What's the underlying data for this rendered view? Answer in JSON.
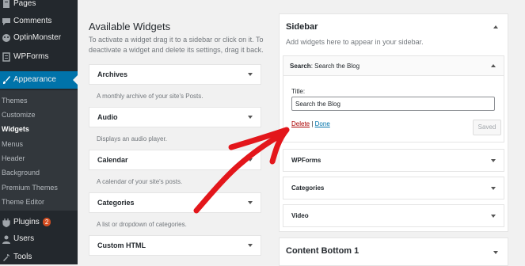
{
  "admin_menu": {
    "pages": "Pages",
    "comments": "Comments",
    "optinmonster": "OptinMonster",
    "wpforms": "WPForms",
    "appearance": "Appearance",
    "plugins": "Plugins",
    "plugins_badge": "2",
    "users": "Users",
    "tools": "Tools",
    "submenu": [
      "Themes",
      "Customize",
      "Widgets",
      "Menus",
      "Header",
      "Background",
      "Premium Themes",
      "Theme Editor"
    ]
  },
  "available": {
    "title": "Available Widgets",
    "description": "To activate a widget drag it to a sidebar or click on it. To deactivate a widget and delete its settings, drag it back.",
    "widgets": [
      {
        "name": "Archives",
        "desc": "A monthly archive of your site's Posts."
      },
      {
        "name": "Audio",
        "desc": "Displays an audio player."
      },
      {
        "name": "Calendar",
        "desc": "A calendar of your site's posts."
      },
      {
        "name": "Categories",
        "desc": "A list or dropdown of categories."
      },
      {
        "name": "Custom HTML",
        "desc": ""
      }
    ]
  },
  "sidebar": {
    "title": "Sidebar",
    "description": "Add widgets here to appear in your sidebar.",
    "search_widget": {
      "name": "Search",
      "subtitle": ": Search the Blog",
      "field_label": "Title:",
      "field_value": "Search the Blog",
      "delete": "Delete",
      "separator": " | ",
      "done": "Done",
      "saved": "Saved"
    },
    "widgets": [
      "WPForms",
      "Categories",
      "Video"
    ]
  },
  "content_bottom": {
    "title": "Content Bottom 1"
  },
  "colors": {
    "admin_bg": "#23282d",
    "active": "#0073aa",
    "arrow": "#e3161b"
  }
}
